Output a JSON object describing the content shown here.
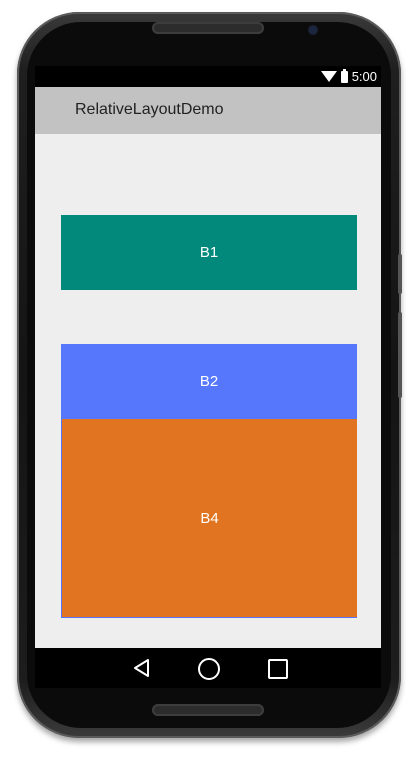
{
  "status": {
    "time": "5:00",
    "icons": [
      "wifi-icon",
      "battery-icon"
    ]
  },
  "app": {
    "title": "RelativeLayoutDemo"
  },
  "buttons": {
    "b1": {
      "label": "B1",
      "color": "#03897b"
    },
    "b2": {
      "label": "B2",
      "color": "#5677fc"
    },
    "b4": {
      "label": "B4",
      "color": "#e07420"
    }
  },
  "navigation": {
    "icons": [
      "back-icon",
      "home-icon",
      "recent-apps-icon"
    ]
  }
}
